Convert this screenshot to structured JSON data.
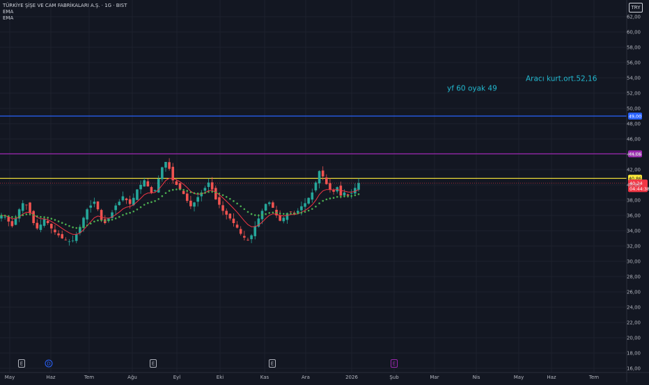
{
  "legend": {
    "symbol_title": "TÜRKİYE ŞİŞE VE CAM FABRİKALARI A.Ş. · 1G · BIST",
    "ema1_label": "EMA",
    "ema2_label": "EMA"
  },
  "currency_button": "TRY",
  "colors": {
    "background": "#131722",
    "grid": "#1e222d",
    "axis_text": "#b2b5be",
    "candle_up": "#26a69a",
    "candle_down": "#ef5350",
    "ema_fast": "#f23645",
    "ema_slow": "#4caf50",
    "line_blue": "#2962ff",
    "line_purple": "#9c27b0",
    "line_yellow": "#ffeb3b",
    "annotation_text": "#22b8cf"
  },
  "chart_data": {
    "type": "candlestick",
    "title": "TÜRKİYE ŞİŞE VE CAM FABRİKALARI A.Ş. · 1G · BIST",
    "y_axis": {
      "ticks": [
        "62,00",
        "60,00",
        "58,00",
        "56,00",
        "54,00",
        "52,00",
        "50,00",
        "48,00",
        "46,00",
        "44,00",
        "42,00",
        "40,00",
        "38,00",
        "36,00",
        "34,00",
        "32,00",
        "30,00",
        "28,00",
        "26,00",
        "24,00",
        "22,00",
        "20,00",
        "18,00",
        "16,00"
      ],
      "ylim": [
        15.6,
        63.0
      ],
      "position": "right"
    },
    "x_axis": {
      "ticks": [
        "May",
        "Haz",
        "Tem",
        "Ağu",
        "Eyl",
        "Eki",
        "Kas",
        "Ara",
        "2026",
        "Şub",
        "Mar",
        "Nis",
        "May",
        "Haz",
        "Tem"
      ]
    },
    "grid": true,
    "series_ohlc_description": "daily candles May 2025 – Jan 2026",
    "close_path": [
      36.0,
      35.8,
      35.2,
      34.6,
      35.6,
      36.8,
      37.6,
      37.4,
      36.3,
      35.0,
      34.3,
      34.8,
      35.5,
      35.0,
      34.3,
      33.8,
      33.4,
      33.0,
      32.8,
      32.6,
      32.7,
      33.5,
      34.5,
      35.7,
      36.8,
      37.3,
      37.8,
      36.8,
      35.4,
      35.0,
      35.6,
      36.4,
      37.3,
      37.8,
      38.5,
      38.0,
      37.5,
      38.3,
      39.4,
      40.0,
      40.6,
      39.8,
      39.0,
      39.3,
      40.8,
      42.3,
      43.0,
      42.1,
      40.6,
      40.0,
      39.4,
      38.8,
      37.9,
      37.2,
      37.7,
      38.4,
      39.0,
      39.6,
      40.3,
      39.4,
      38.1,
      37.4,
      36.6,
      36.1,
      35.6,
      35.0,
      34.4,
      33.6,
      33.1,
      32.8,
      33.4,
      34.6,
      35.6,
      36.6,
      37.5,
      37.7,
      37.0,
      36.0,
      35.3,
      35.7,
      36.3,
      36.5,
      36.2,
      36.6,
      37.2,
      37.6,
      38.3,
      39.0,
      40.3,
      41.8,
      41.1,
      40.1,
      39.4,
      39.1,
      39.7,
      38.6,
      39.0,
      38.6,
      38.9,
      39.6,
      40.24
    ],
    "ema_fast": "red line",
    "ema_slow": "green dotted line",
    "horizontal_lines": [
      {
        "value": 49.0,
        "label": "49,00",
        "color": "#2962ff"
      },
      {
        "value": 44.06,
        "label": "44,06",
        "color": "#9c27b0"
      },
      {
        "value": 40.86,
        "label": "40,86",
        "color": "#ffeb3b"
      }
    ],
    "last_price": {
      "value": 40.24,
      "label": "40,24",
      "countdown": "04:44:38",
      "color": "#f23645"
    },
    "annotations": [
      {
        "text": "Aracı kurt.ort.52,16",
        "value": 53.6
      },
      {
        "text": "yf 60 oyak 49",
        "value": 52.3
      }
    ],
    "event_markers": [
      {
        "symbol": "E",
        "x_label": "May",
        "color": "#b2b5be"
      },
      {
        "symbol": "D",
        "x_label": "Haz",
        "color": "#2962ff"
      },
      {
        "symbol": "E",
        "x_label": "Ağu",
        "color": "#b2b5be"
      },
      {
        "symbol": "E",
        "x_label": "Kas",
        "color": "#b2b5be"
      },
      {
        "symbol": "E",
        "x_label": "Şub",
        "color": "#9c27b0"
      }
    ]
  }
}
